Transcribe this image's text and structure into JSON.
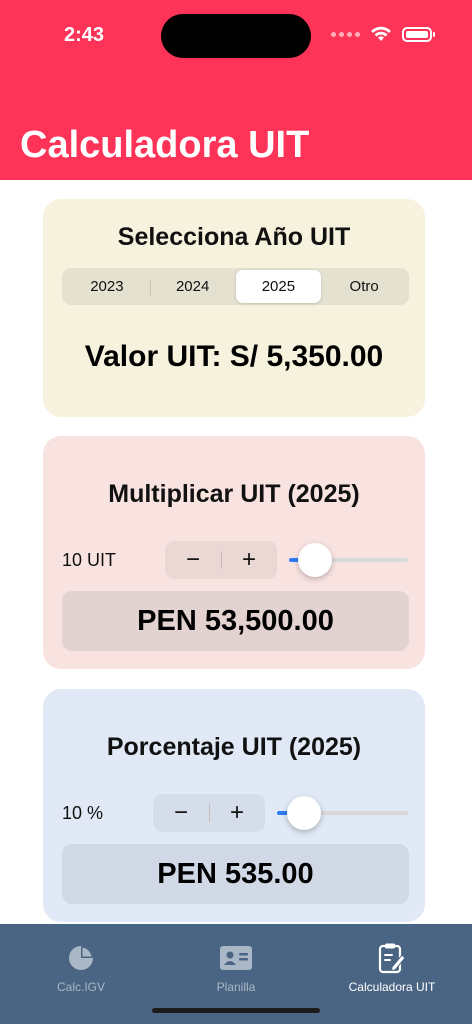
{
  "status": {
    "time": "2:43"
  },
  "header": {
    "title": "Calculadora UIT"
  },
  "year_card": {
    "title": "Selecciona Año UIT",
    "segments": [
      "2023",
      "2024",
      "2025",
      "Otro"
    ],
    "selected_index": 2,
    "value_text": "Valor UIT: S/ 5,350.00"
  },
  "multiply_card": {
    "title": "Multiplicar UIT (2025)",
    "count_label": "10 UIT",
    "minus": "−",
    "plus": "+",
    "slider_fraction": 0.1,
    "result": "PEN 53,500.00"
  },
  "percent_card": {
    "title": "Porcentaje UIT (2025)",
    "count_label": "10 %",
    "minus": "−",
    "plus": "+",
    "slider_fraction": 0.1,
    "result": "PEN 535.00"
  },
  "tabbar": {
    "items": [
      {
        "label": "Calc.IGV",
        "icon": "pie-chart-icon"
      },
      {
        "label": "Planilla",
        "icon": "id-card-icon"
      },
      {
        "label": "Calculadora UIT",
        "icon": "clipboard-edit-icon"
      }
    ],
    "active_index": 2
  },
  "colors": {
    "header": "#fe3358",
    "year_card": "#f7f2dd",
    "multiply_card": "#f9e3e1",
    "percent_card": "#e0e9f5",
    "tabbar": "#4a6583",
    "slider_accent": "#2f7cf6"
  }
}
